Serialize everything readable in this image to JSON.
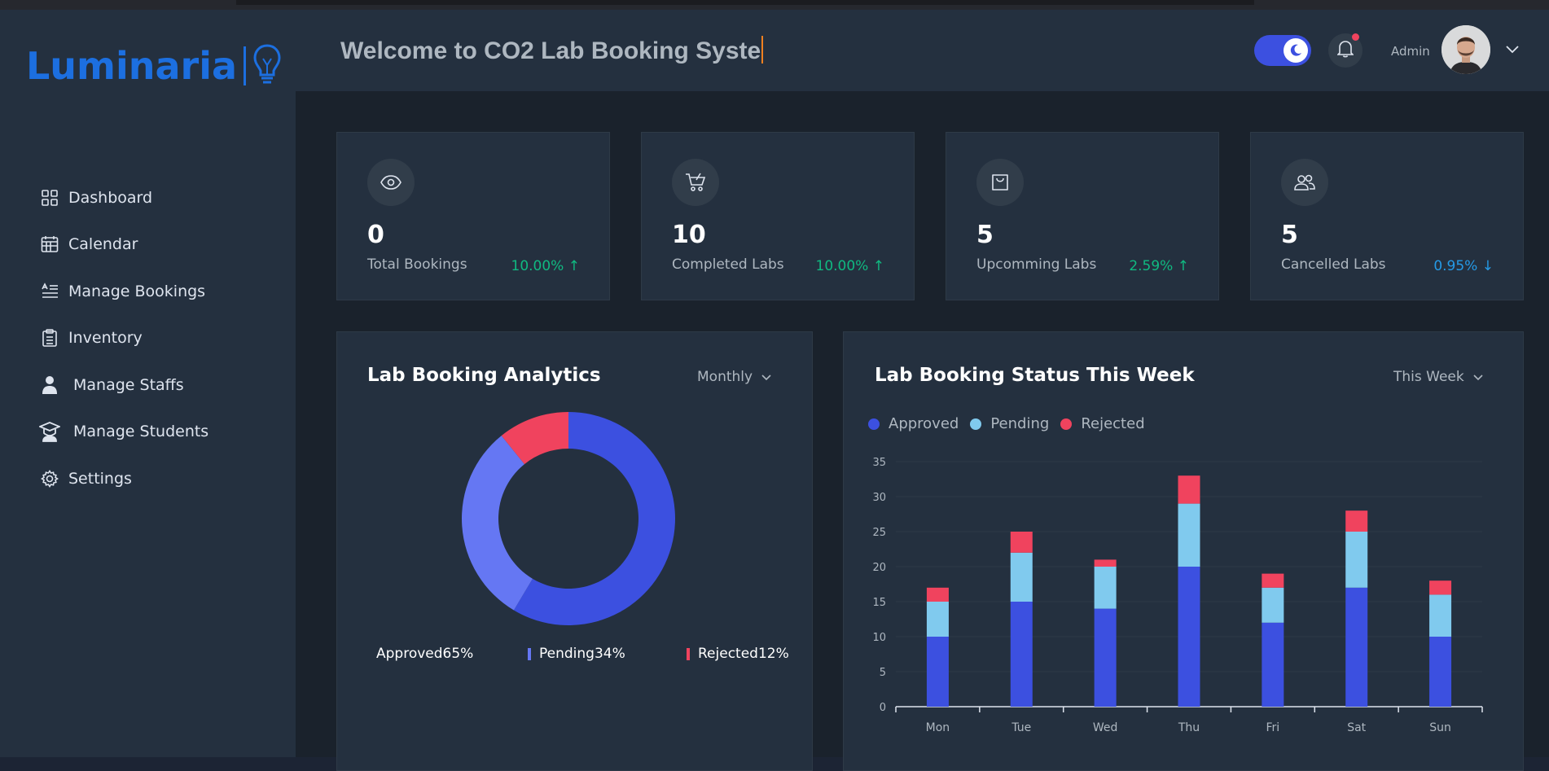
{
  "brand": {
    "name": "Luminaria",
    "color": "#1c6fe0"
  },
  "sidebar": {
    "items": [
      {
        "label": "Dashboard",
        "icon": "grid-icon"
      },
      {
        "label": "Calendar",
        "icon": "calendar-icon"
      },
      {
        "label": "Manage Bookings",
        "icon": "list-icon"
      },
      {
        "label": "Inventory",
        "icon": "clipboard-icon"
      },
      {
        "label": "Manage Staffs",
        "icon": "user-icon"
      },
      {
        "label": "Manage Students",
        "icon": "graduation-cap-icon"
      },
      {
        "label": "Settings",
        "icon": "gear-icon"
      }
    ]
  },
  "header": {
    "welcome": "Welcome to CO2 Lab Booking Syste",
    "theme_toggle": "dark",
    "user_label": "Admin",
    "notification_dot_color": "#f0435e"
  },
  "stats": [
    {
      "value": "0",
      "label": "Total Bookings",
      "change": "10.00%",
      "direction": "up",
      "icon": "eye-icon"
    },
    {
      "value": "10",
      "label": "Completed Labs",
      "change": "10.00%",
      "direction": "up",
      "icon": "cart-icon"
    },
    {
      "value": "5",
      "label": "Upcomming Labs",
      "change": "2.59%",
      "direction": "up",
      "icon": "bag-icon"
    },
    {
      "value": "5",
      "label": "Cancelled Labs",
      "change": "0.95%",
      "direction": "down",
      "icon": "users-icon"
    }
  ],
  "analytics": {
    "title": "Lab Booking Analytics",
    "period": "Monthly",
    "legend": [
      {
        "label": "Approved65%",
        "color": "#3c50e0"
      },
      {
        "label": "Pending34%",
        "color": "#6577f3"
      },
      {
        "label": "Rejected12%",
        "color": "#f0435e"
      }
    ]
  },
  "status": {
    "title": "Lab Booking Status This Week",
    "period": "This Week",
    "legend": [
      {
        "label": "Approved",
        "color": "#3c50e0"
      },
      {
        "label": "Pending",
        "color": "#80caee"
      },
      {
        "label": "Rejected",
        "color": "#f0435e"
      }
    ]
  },
  "chart_data": [
    {
      "type": "pie",
      "title": "Lab Booking Analytics",
      "categories": [
        "Approved",
        "Pending",
        "Rejected"
      ],
      "values": [
        65,
        34,
        12
      ],
      "colors": [
        "#3c50e0",
        "#6577f3",
        "#f0435e"
      ],
      "donut": true
    },
    {
      "type": "bar",
      "stacked": true,
      "title": "Lab Booking Status This Week",
      "categories": [
        "Mon",
        "Tue",
        "Wed",
        "Thu",
        "Fri",
        "Sat",
        "Sun"
      ],
      "series": [
        {
          "name": "Approved",
          "values": [
            10,
            15,
            14,
            20,
            12,
            17,
            10
          ],
          "color": "#3c50e0"
        },
        {
          "name": "Pending",
          "values": [
            5,
            7,
            6,
            9,
            5,
            8,
            6
          ],
          "color": "#80caee"
        },
        {
          "name": "Rejected",
          "values": [
            2,
            3,
            1,
            4,
            2,
            3,
            2
          ],
          "color": "#f0435e"
        }
      ],
      "ylim": [
        0,
        35
      ],
      "yticks": [
        0,
        5,
        10,
        15,
        20,
        25,
        30,
        35
      ],
      "grid": true,
      "legend_position": "top-left"
    }
  ]
}
